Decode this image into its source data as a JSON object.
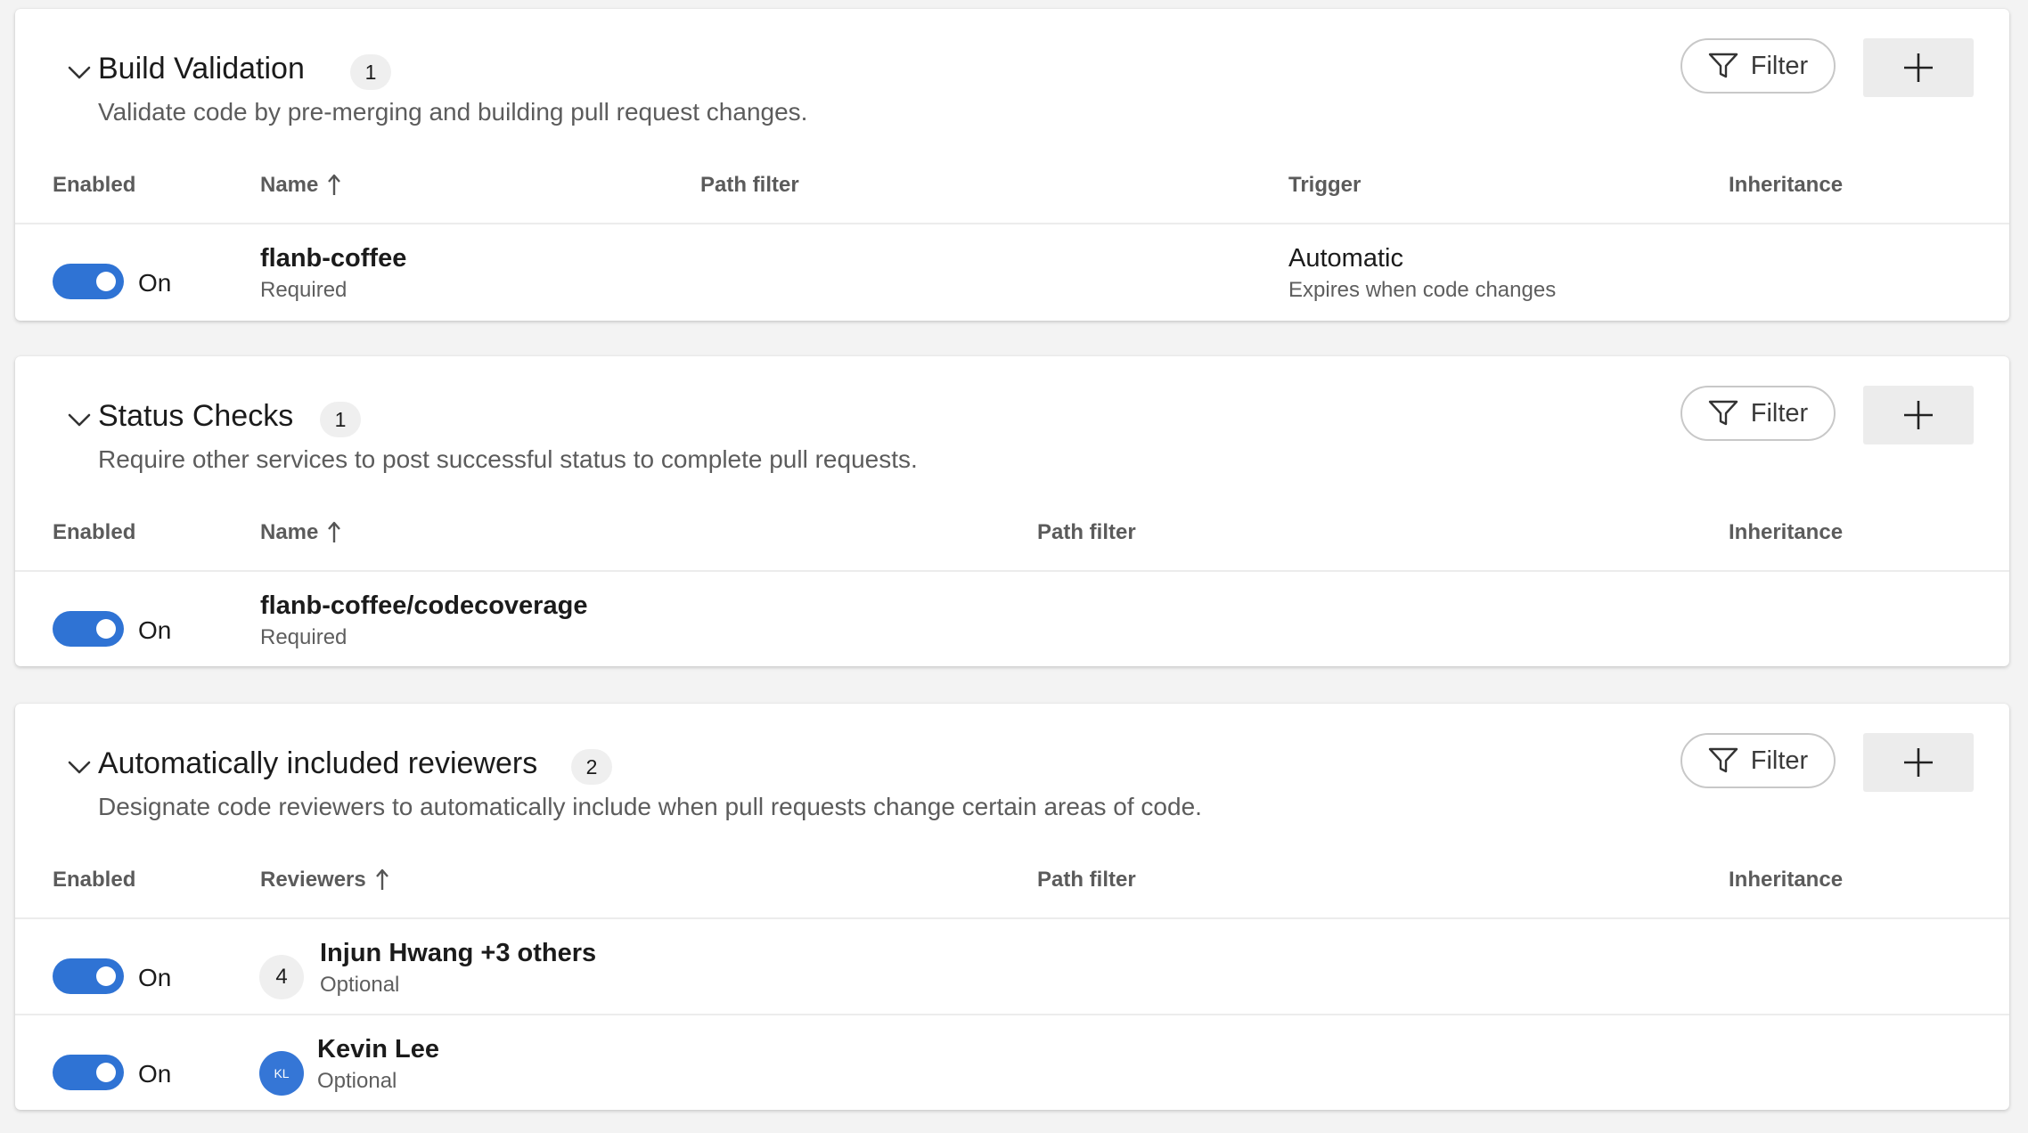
{
  "colors": {
    "accent": "#2f73d4",
    "avatar": "#3576d6"
  },
  "sections": [
    {
      "title": "Build Validation",
      "count": "1",
      "description": "Validate code by pre-merging and building pull request changes.",
      "filter_label": "Filter",
      "columns": {
        "enabled": "Enabled",
        "name": "Name",
        "path_filter": "Path filter",
        "trigger": "Trigger",
        "inheritance": "Inheritance"
      },
      "rows": [
        {
          "toggle_label": "On",
          "name": "flanb-coffee",
          "requirement": "Required",
          "trigger": "Automatic",
          "trigger_detail": "Expires when code changes"
        }
      ]
    },
    {
      "title": "Status Checks",
      "count": "1",
      "description": "Require other services to post successful status to complete pull requests.",
      "filter_label": "Filter",
      "columns": {
        "enabled": "Enabled",
        "name": "Name",
        "path_filter": "Path filter",
        "inheritance": "Inheritance"
      },
      "rows": [
        {
          "toggle_label": "On",
          "name": "flanb-coffee/codecoverage",
          "requirement": "Required"
        }
      ]
    },
    {
      "title": "Automatically included reviewers",
      "count": "2",
      "description": "Designate code reviewers to automatically include when pull requests change certain areas of code.",
      "filter_label": "Filter",
      "columns": {
        "enabled": "Enabled",
        "reviewers": "Reviewers",
        "path_filter": "Path filter",
        "inheritance": "Inheritance"
      },
      "rows": [
        {
          "toggle_label": "On",
          "reviewer_count": "4",
          "name": "Injun Hwang +3 others",
          "requirement": "Optional"
        },
        {
          "toggle_label": "On",
          "avatar_initials": "KL",
          "name": "Kevin Lee",
          "requirement": "Optional"
        }
      ]
    }
  ]
}
